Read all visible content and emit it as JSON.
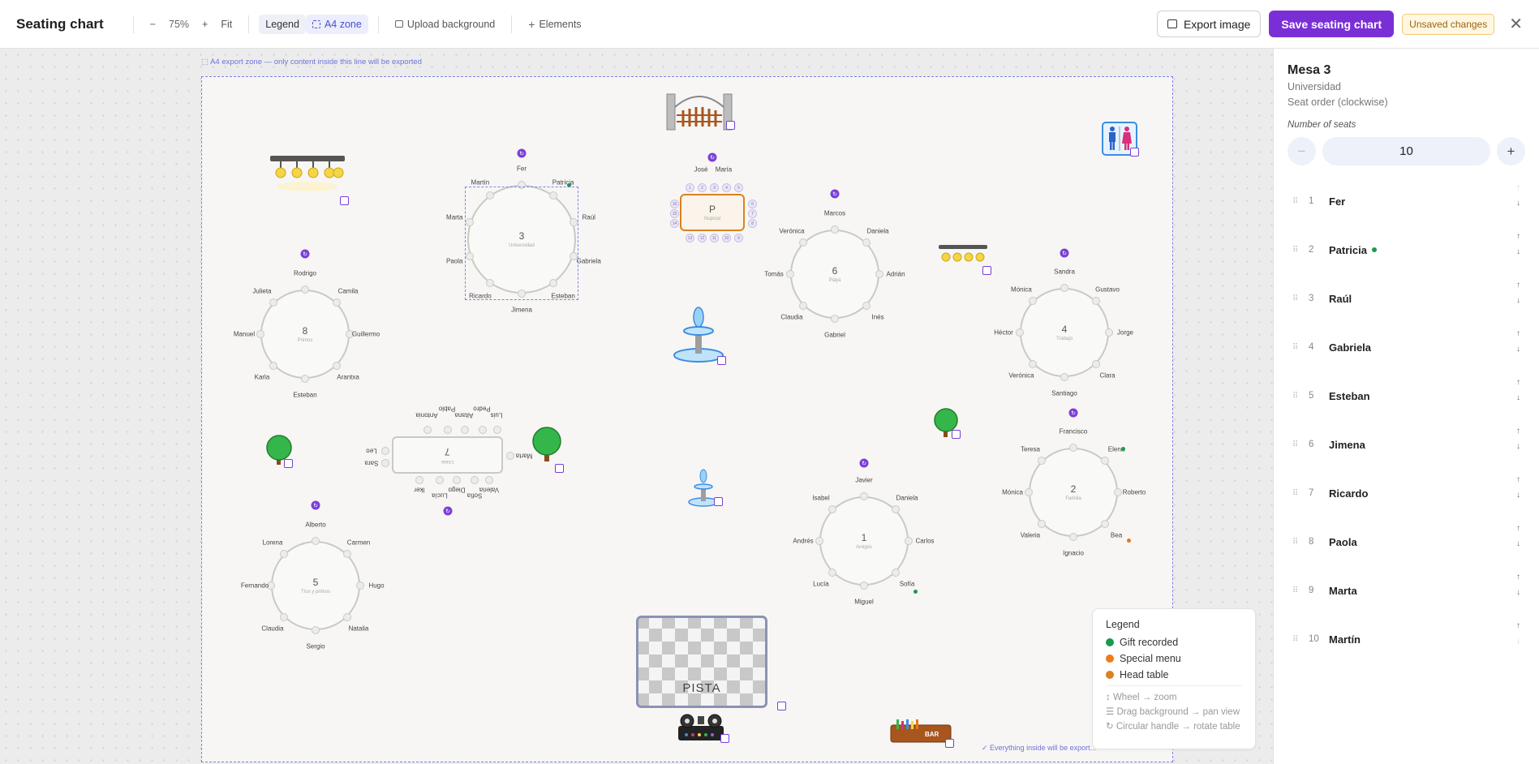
{
  "toolbar": {
    "title": "Seating chart",
    "zoom_out": "−",
    "zoom_value": "75%",
    "zoom_in": "+",
    "fit": "Fit",
    "legend": "Legend",
    "a4zone": "A4 zone",
    "upload_background": "Upload background",
    "elements": "Elements",
    "export_image": "Export image",
    "save": "Save seating chart",
    "unsaved": "Unsaved changes",
    "close": "✕"
  },
  "canvas": {
    "zone_label": "A4 export zone — only content inside this line will be exported",
    "zone_footer": "Everything inside will be export..."
  },
  "tables": [
    {
      "num": "3",
      "name": "Universidad",
      "guests": [
        "Fer",
        "Patricia",
        "Raúl",
        "Gabriela",
        "Esteban",
        "Jimena",
        "Ricardo",
        "Paola",
        "Marta",
        "Martín"
      ]
    },
    {
      "num": "6",
      "name": "Playa",
      "guests": [
        "Marcos",
        "Daniela",
        "Adrián",
        "Inés",
        "Gabriel",
        "Claudia",
        "Tomás",
        "Verónica"
      ]
    },
    {
      "num": "8",
      "name": "Primos",
      "guests": [
        "Rodrigo",
        "Camila",
        "Guillermo",
        "Arantxa",
        "Esteban",
        "Karla",
        "Manuel",
        "Julieta"
      ]
    },
    {
      "num": "4",
      "name": "Trabajo",
      "guests": [
        "Sandra",
        "Gustavo",
        "Jorge",
        "Clara",
        "Santiago",
        "Verónica",
        "Héctor",
        "Mónica"
      ]
    },
    {
      "num": "2",
      "name": "Familia",
      "guests": [
        "Francisco",
        "Elena",
        "Roberto",
        "Bea",
        "Ignacio",
        "Valeria",
        "Mónica",
        "Teresa"
      ]
    },
    {
      "num": "1",
      "name": "Amigos",
      "guests": [
        "Javier",
        "Daniela",
        "Carlos",
        "Sofía",
        "Miguel",
        "Lucía",
        "Andrés",
        "Isabel"
      ]
    },
    {
      "num": "5",
      "name": "Tíos y primos",
      "guests": [
        "Alberto",
        "Carmen",
        "Hugo",
        "Natalia",
        "Sergio",
        "Claudia",
        "Fernando",
        "Lorena"
      ]
    },
    {
      "num": "7",
      "name": "Clase",
      "guests": [
        "Antonia",
        "Pablo",
        "Aitana",
        "Pedro",
        "Luis",
        "Marta",
        "Valeria",
        "Sofía",
        "Diego",
        "Lucía",
        "Iker",
        "Sara",
        "Leo"
      ]
    }
  ],
  "head_table": {
    "letter": "P",
    "name": "Nupcial",
    "guests": [
      "José",
      "María"
    ],
    "seat_numbers": [
      "1",
      "2",
      "3",
      "4",
      "5",
      "6",
      "7",
      "8",
      "9",
      "10",
      "11",
      "12",
      "13",
      "14",
      "15",
      "16"
    ]
  },
  "dance_floor": "PISTA",
  "bar_label": "BAR",
  "legend": {
    "title": "Legend",
    "items": [
      {
        "label": "Gift recorded",
        "color": "#1a9a4c"
      },
      {
        "label": "Special menu",
        "color": "#f07a1a"
      },
      {
        "label": "Head table",
        "color": "#d9831f"
      }
    ],
    "hints": [
      "↕ Wheel → zoom",
      "☰ Drag background → pan view",
      "↻ Circular handle → rotate table"
    ]
  },
  "panel": {
    "title": "Mesa 3",
    "subtitle": "Universidad",
    "seat_order": "Seat order (clockwise)",
    "number_of_seats_label": "Number of seats",
    "seats_value": "10",
    "minus": "−",
    "plus": "+",
    "seats": [
      {
        "n": "1",
        "name": "Fer",
        "gift": false
      },
      {
        "n": "2",
        "name": "Patricia",
        "gift": true
      },
      {
        "n": "3",
        "name": "Raúl",
        "gift": false
      },
      {
        "n": "4",
        "name": "Gabriela",
        "gift": false
      },
      {
        "n": "5",
        "name": "Esteban",
        "gift": false
      },
      {
        "n": "6",
        "name": "Jimena",
        "gift": false
      },
      {
        "n": "7",
        "name": "Ricardo",
        "gift": false
      },
      {
        "n": "8",
        "name": "Paola",
        "gift": false
      },
      {
        "n": "9",
        "name": "Marta",
        "gift": false
      },
      {
        "n": "10",
        "name": "Martín",
        "gift": false
      }
    ]
  }
}
